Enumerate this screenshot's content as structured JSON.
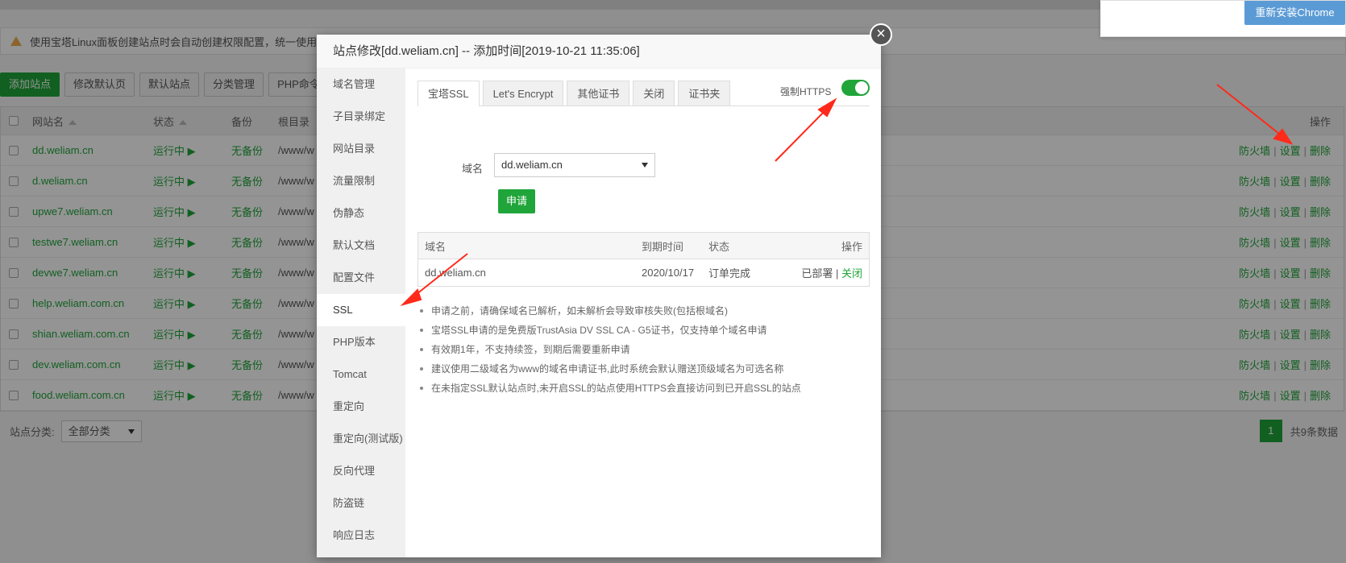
{
  "popup": {
    "reinstall_label": "重新安装Chrome"
  },
  "warning": {
    "text": "使用宝塔Linux面板创建站点时会自动创建权限配置，统一使用www"
  },
  "toolbar": {
    "buttons": [
      "添加站点",
      "修改默认页",
      "默认站点",
      "分类管理",
      "PHP命令行版"
    ]
  },
  "table": {
    "headers": {
      "name": "网站名",
      "status": "状态",
      "backup": "备份",
      "root": "根目录",
      "ops": "操作"
    },
    "rows": [
      {
        "name": "dd.weliam.cn",
        "status": "运行中 ▶",
        "backup": "无备份",
        "root": "/www/w"
      },
      {
        "name": "d.weliam.cn",
        "status": "运行中 ▶",
        "backup": "无备份",
        "root": "/www/w"
      },
      {
        "name": "upwe7.weliam.cn",
        "status": "运行中 ▶",
        "backup": "无备份",
        "root": "/www/w"
      },
      {
        "name": "testwe7.weliam.cn",
        "status": "运行中 ▶",
        "backup": "无备份",
        "root": "/www/w"
      },
      {
        "name": "devwe7.weliam.cn",
        "status": "运行中 ▶",
        "backup": "无备份",
        "root": "/www/w"
      },
      {
        "name": "help.weliam.com.cn",
        "status": "运行中 ▶",
        "backup": "无备份",
        "root": "/www/w"
      },
      {
        "name": "shian.weliam.com.cn",
        "status": "运行中 ▶",
        "backup": "无备份",
        "root": "/www/w"
      },
      {
        "name": "dev.weliam.com.cn",
        "status": "运行中 ▶",
        "backup": "无备份",
        "root": "/www/w"
      },
      {
        "name": "food.weliam.com.cn",
        "status": "运行中 ▶",
        "backup": "无备份",
        "root": "/www/w"
      }
    ],
    "ops": {
      "firewall": "防火墙",
      "settings": "设置",
      "delete": "删除"
    }
  },
  "footer": {
    "category_label": "站点分类:",
    "category_value": "全部分类",
    "page": "1",
    "total": "共9条数据"
  },
  "modal": {
    "title": "站点修改[dd.weliam.cn] -- 添加时间[2019-10-21 11:35:06]",
    "menu": [
      "域名管理",
      "子目录绑定",
      "网站目录",
      "流量限制",
      "伪静态",
      "默认文档",
      "配置文件",
      "SSL",
      "PHP版本",
      "Tomcat",
      "重定向",
      "重定向(测试版)",
      "反向代理",
      "防盗链",
      "响应日志"
    ],
    "active_menu": "SSL",
    "tabs": [
      "宝塔SSL",
      "Let's Encrypt",
      "其他证书",
      "关闭",
      "证书夹"
    ],
    "force_https_label": "强制HTTPS",
    "force_https_on": true,
    "domain_label": "域名",
    "domain_value": "dd.weliam.cn",
    "apply_label": "申请",
    "cert_table": {
      "headers": {
        "domain": "域名",
        "expiry": "到期时间",
        "status": "状态",
        "ops": "操作"
      },
      "row": {
        "domain": "dd.weliam.cn",
        "expiry": "2020/10/17",
        "status": "订单完成",
        "deployed": "已部署",
        "sep": "|",
        "close": "关闭"
      }
    },
    "notes": [
      "申请之前，请确保域名已解析，如未解析会导致审核失败(包括根域名)",
      "宝塔SSL申请的是免费版TrustAsia DV SSL CA - G5证书，仅支持单个域名申请",
      "有效期1年，不支持续签，到期后需要重新申请",
      "建议使用二级域名为www的域名申请证书,此时系统会默认赠送顶级域名为可选名称",
      "在未指定SSL默认站点时,未开启SSL的站点使用HTTPS会直接访问到已开启SSL的站点"
    ]
  },
  "colors": {
    "accent": "#20a53a",
    "arrow": "#ff2a1a"
  }
}
